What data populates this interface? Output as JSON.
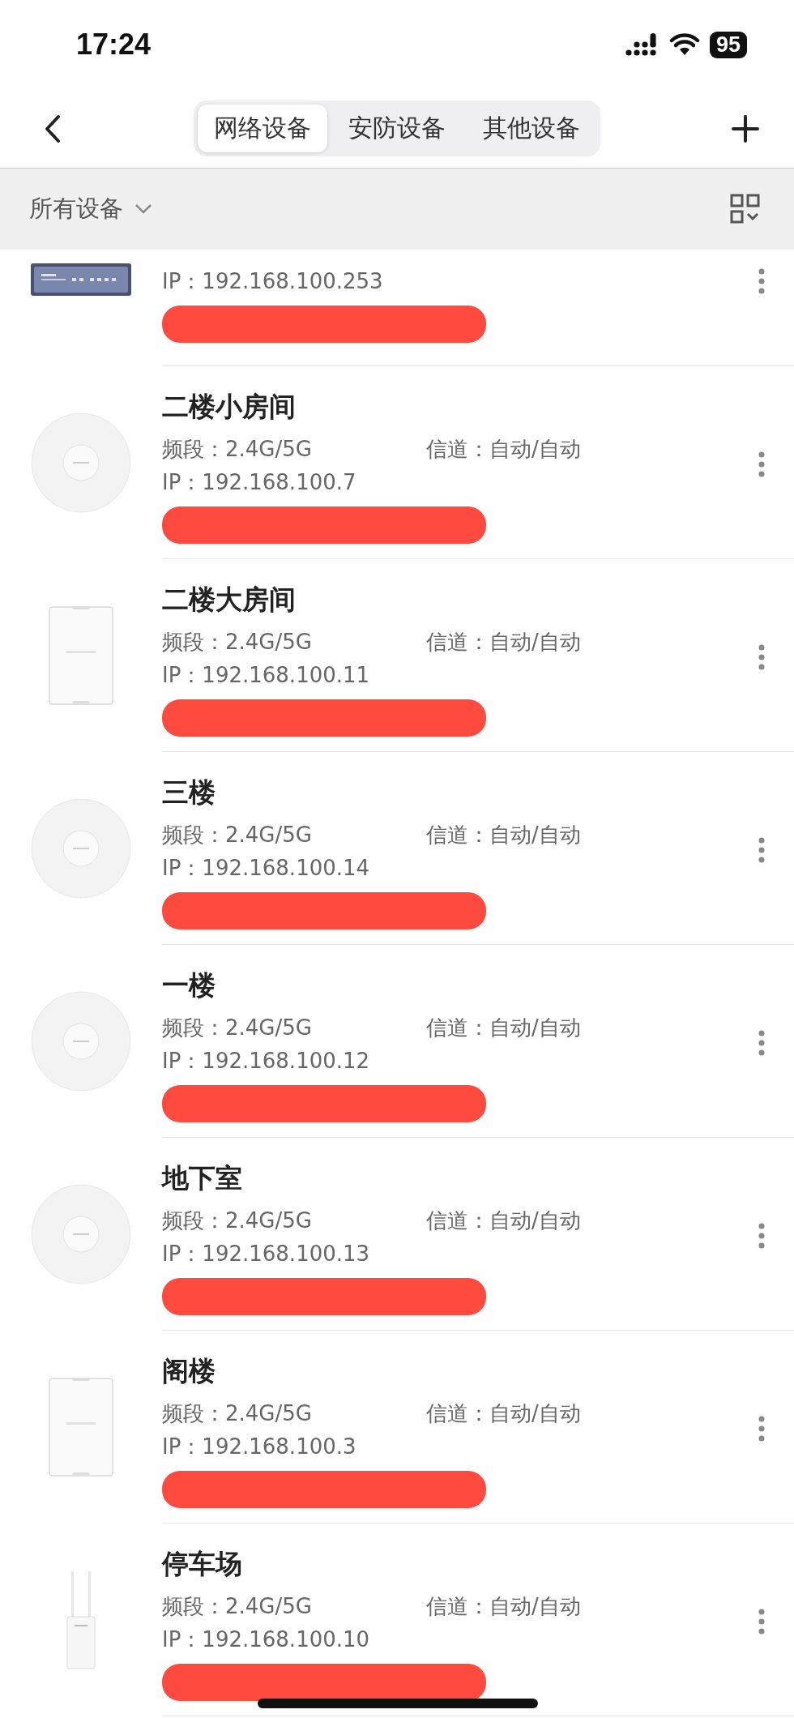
{
  "status_bar": {
    "time": "17:24",
    "battery": "95"
  },
  "nav": {
    "tabs": [
      {
        "label": "网络设备",
        "selected": true
      },
      {
        "label": "安防设备",
        "selected": false
      },
      {
        "label": "其他设备",
        "selected": false
      }
    ]
  },
  "filter": {
    "label": "所有设备"
  },
  "devices": [
    {
      "kind": "switch",
      "ip": "IP：192.168.100.253"
    },
    {
      "kind": "ceiling-ap",
      "name": "二楼小房间",
      "band": "频段：2.4G/5G",
      "channel": "信道：自动/自动",
      "ip": "IP：192.168.100.7"
    },
    {
      "kind": "wall-ap",
      "name": "二楼大房间",
      "band": "频段：2.4G/5G",
      "channel": "信道：自动/自动",
      "ip": "IP：192.168.100.11"
    },
    {
      "kind": "ceiling-ap",
      "name": "三楼",
      "band": "频段：2.4G/5G",
      "channel": "信道：自动/自动",
      "ip": "IP：192.168.100.14"
    },
    {
      "kind": "ceiling-ap",
      "name": "一楼",
      "band": "频段：2.4G/5G",
      "channel": "信道：自动/自动",
      "ip": "IP：192.168.100.12"
    },
    {
      "kind": "ceiling-ap",
      "name": "地下室",
      "band": "频段：2.4G/5G",
      "channel": "信道：自动/自动",
      "ip": "IP：192.168.100.13"
    },
    {
      "kind": "wall-ap",
      "name": "阁楼",
      "band": "频段：2.4G/5G",
      "channel": "信道：自动/自动",
      "ip": "IP：192.168.100.3"
    },
    {
      "kind": "outdoor-ap",
      "name": "停车场",
      "band": "频段：2.4G/5G",
      "channel": "信道：自动/自动",
      "ip": "IP：192.168.100.10"
    }
  ]
}
